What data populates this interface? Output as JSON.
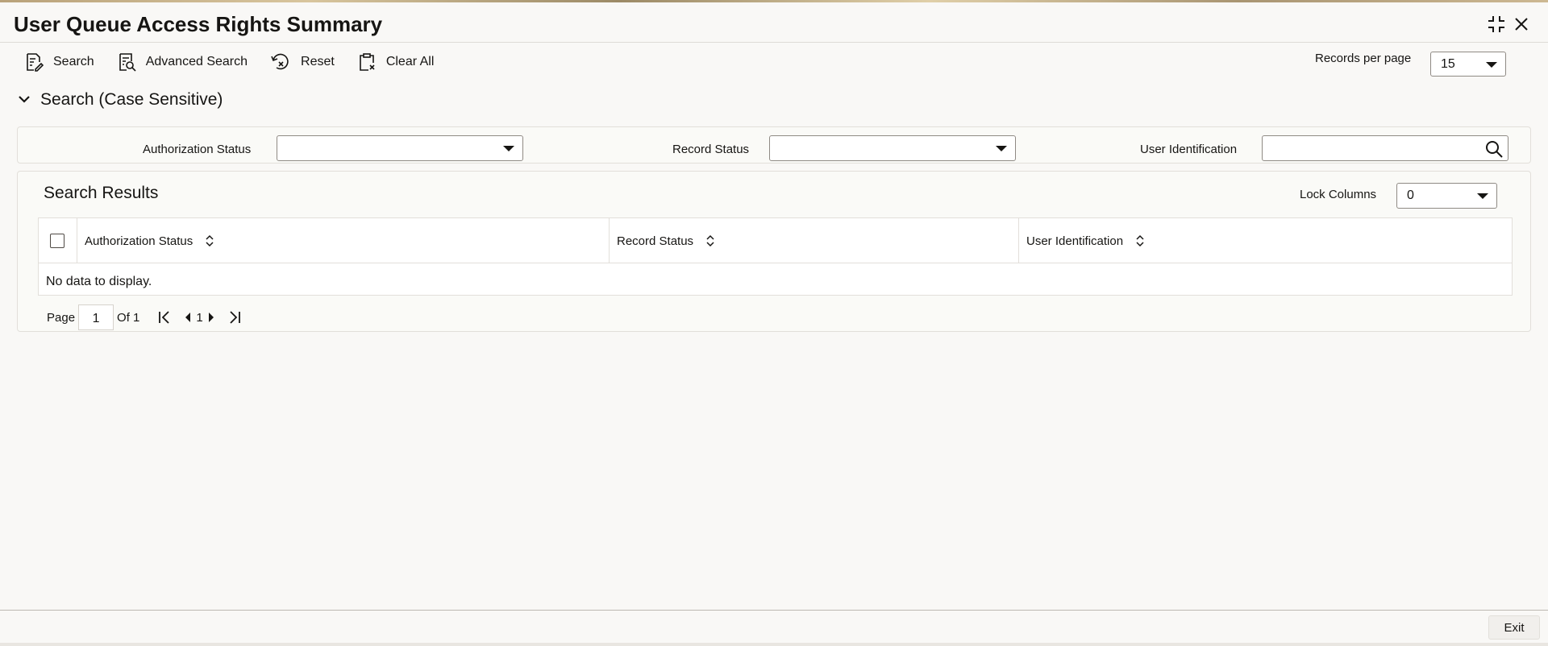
{
  "window": {
    "title": "User Queue Access Rights Summary",
    "icons": [
      "maximize-icon",
      "close-icon"
    ]
  },
  "toolbar": {
    "search_label": "Search",
    "advanced_search_label": "Advanced Search",
    "reset_label": "Reset",
    "clear_all_label": "Clear All"
  },
  "records_per_page": {
    "label": "Records per page",
    "value": "15"
  },
  "search_section": {
    "title": "Search (Case Sensitive)",
    "fields": [
      {
        "label": "Authorization Status",
        "value": ""
      },
      {
        "label": "Record Status",
        "value": ""
      },
      {
        "label": "User Identification",
        "value": ""
      }
    ]
  },
  "results": {
    "title": "Search Results",
    "lock_columns_label": "Lock Columns",
    "lock_columns_value": "0",
    "columns": [
      "Authorization Status",
      "Record Status",
      "User Identification"
    ],
    "empty_message": "No data to display."
  },
  "pagination": {
    "page_label": "Page",
    "current_page": "1",
    "of_label": "Of 1",
    "page_number": "1"
  },
  "footer": {
    "exit_label": "Exit"
  },
  "colors": {
    "text": "#161513",
    "border": "#8f8a84",
    "background": "#f9f8f6"
  }
}
